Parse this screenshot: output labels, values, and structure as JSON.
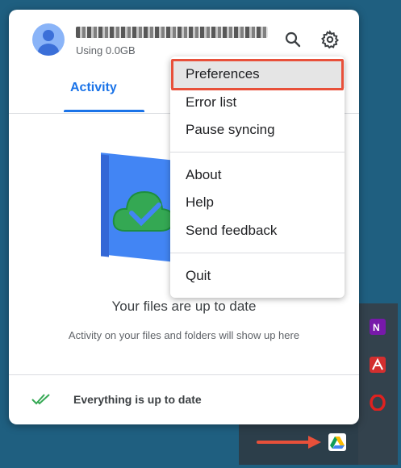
{
  "account": {
    "usage": "Using 0.0GB"
  },
  "tabs": {
    "activity": "Activity"
  },
  "status": {
    "title": "Your files are up to date",
    "subtitle": "Activity on your files and folders will show up here"
  },
  "footer": {
    "text": "Everything is up to date"
  },
  "menu": {
    "items": [
      {
        "label": "Preferences"
      },
      {
        "label": "Error list"
      },
      {
        "label": "Pause syncing"
      },
      {
        "label": "About"
      },
      {
        "label": "Help"
      },
      {
        "label": "Send feedback"
      },
      {
        "label": "Quit"
      }
    ]
  },
  "tray": {
    "icons": [
      "onenote-icon",
      "adobe-icon",
      "opera-icon",
      "google-drive-icon"
    ]
  },
  "colors": {
    "accent": "#1a73e8",
    "highlight_border": "#e8503a",
    "check_green": "#34a853"
  }
}
